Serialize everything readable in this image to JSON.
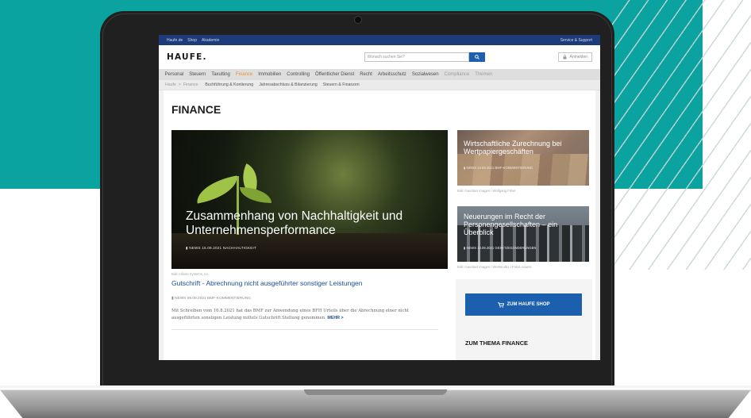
{
  "topbar": {
    "links": [
      "Haufe.de",
      "Shop",
      "Akademie"
    ],
    "right": "Service & Support"
  },
  "header": {
    "logo": "HAUFE.",
    "search_placeholder": "Wonach suchen Sie?",
    "login": "Anmelden"
  },
  "nav": {
    "items": [
      "Personal",
      "Steuern",
      "Taxulting",
      "Finance",
      "Immobilien",
      "Controlling",
      "Öffentlicher Dienst",
      "Recht",
      "Arbeitsschutz",
      "Sozialwesen",
      "Compliance",
      "Themen"
    ],
    "active_index": 3
  },
  "subnav": {
    "breadcrumb": [
      "Haufe",
      ">",
      "Finance"
    ],
    "items": [
      "Buchführung & Kontierung",
      "Jahresabschluss & Bilanzierung",
      "Steuern & Finanzen"
    ]
  },
  "page": {
    "title": "FINANCE"
  },
  "hero": {
    "title": "Zusammenhang von Nachhaltigkeit und Unternehmensperformance",
    "meta": "NEWS   15.09.2021   NACHHALTIGKEIT",
    "caption": "Bild: Infinite Systems, Inc."
  },
  "cards": [
    {
      "title": "Wirtschaftliche Zurechnung bei Wertpapiergeschäften",
      "meta": "NEWS   14.09.2021   BMF-KOMMENTIERUNG",
      "caption": "Bild: mauritius images / Wolfgang Filser"
    },
    {
      "title": "Neuerungen im Recht der Personengesellschaften – ein Überblick",
      "meta": "NEWS   13.09.2021   GESETZESÄNDERUNGEN",
      "caption": "Bild: mauritius images / Westend61 / Fotos Adams"
    }
  ],
  "article": {
    "title": "Gutschrift - Abrechnung nicht ausgeführter sonstiger Leistungen",
    "meta": "NEWS   09.09.2021   BMF-KOMMENTIERUNG",
    "body": "Mit Schreiben vom 16.8.2021 hat das BMF zur Anwendung eines BFH Urteils über die Abrechnung einer nicht ausgeführten sonstigen Leistung mittels Gutschrift Stellung genommen.",
    "more": "MEHR  >"
  },
  "sidebar": {
    "shop_button": "ZUM HAUFE SHOP",
    "thema_heading": "ZUM THEMA FINANCE"
  },
  "colors": {
    "teal": "#0aa39f",
    "haufe_blue": "#1b5fae",
    "topbar_blue": "#1d3b78",
    "nav_active": "#e8942c"
  }
}
